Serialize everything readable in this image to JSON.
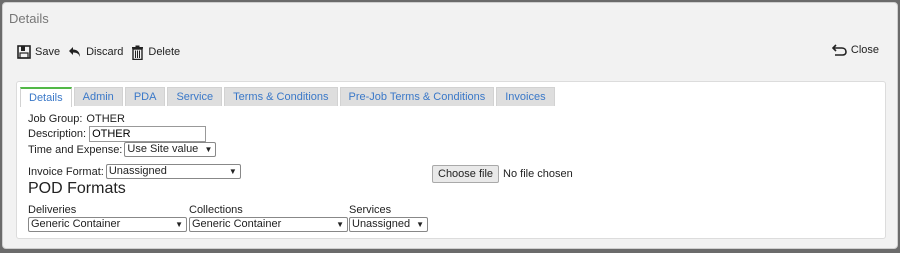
{
  "window": {
    "title": "Details"
  },
  "toolbar": {
    "save_label": "Save",
    "discard_label": "Discard",
    "delete_label": "Delete",
    "close_label": "Close"
  },
  "tabs": [
    {
      "label": "Details",
      "active": true
    },
    {
      "label": "Admin"
    },
    {
      "label": "PDA"
    },
    {
      "label": "Service"
    },
    {
      "label": "Terms & Conditions"
    },
    {
      "label": "Pre-Job Terms & Conditions"
    },
    {
      "label": "Invoices"
    }
  ],
  "form": {
    "job_group_label": "Job Group:",
    "job_group_value": "OTHER",
    "description_label": "Description:",
    "description_value": "OTHER",
    "time_expense_label": "Time and Expense:",
    "time_expense_value": "Use Site value",
    "invoice_format_label": "Invoice Format:",
    "invoice_format_value": "Unassigned",
    "file_button_label": "Choose file",
    "file_status": "No file chosen"
  },
  "pod": {
    "title": "POD Formats",
    "deliveries_label": "Deliveries",
    "deliveries_value": "Generic Container",
    "collections_label": "Collections",
    "collections_value": "Generic Container",
    "services_label": "Services",
    "services_value": "Unassigned"
  },
  "colors": {
    "link": "#3a78c8",
    "active_tab_accent": "#52b847"
  }
}
